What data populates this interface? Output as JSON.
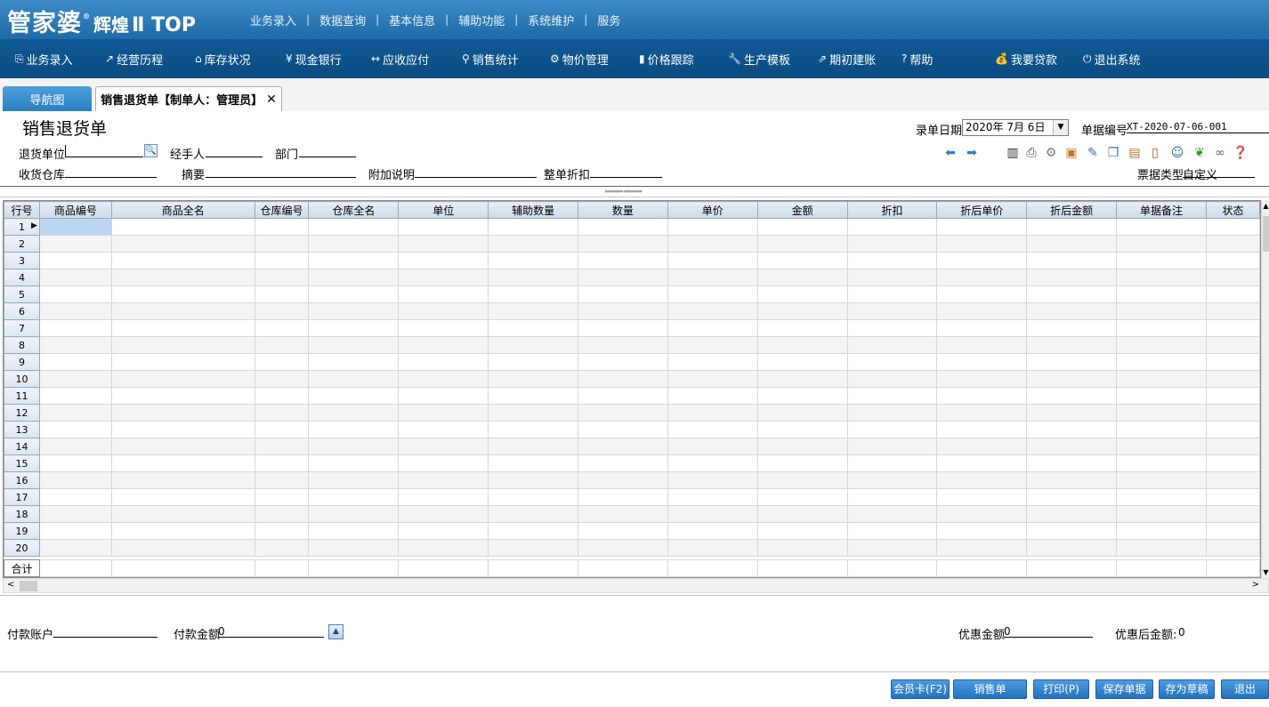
{
  "app": {
    "logo_main": "管家婆",
    "logo_sub": "辉煌",
    "logo_tail": "Ⅱ TOP",
    "logo_reg": "®"
  },
  "top_menu": [
    "业务录入",
    "数据查询",
    "基本信息",
    "辅助功能",
    "系统维护",
    "服务"
  ],
  "top_menu_sep": "|",
  "nav": [
    {
      "icon": "⎘",
      "label": "业务录入",
      "icon_name": "entry-icon"
    },
    {
      "icon": "↗",
      "label": "经营历程",
      "icon_name": "chart-line-icon"
    },
    {
      "icon": "⌂",
      "label": "库存状况",
      "icon_name": "home-icon"
    },
    {
      "icon": "¥",
      "label": "现金银行",
      "icon_name": "yen-icon"
    },
    {
      "icon": "↔",
      "label": "应收应付",
      "icon_name": "exchange-icon"
    },
    {
      "icon": "⚲",
      "label": "销售统计",
      "icon_name": "search-icon"
    },
    {
      "icon": "⚙",
      "label": "物价管理",
      "icon_name": "gear-icon"
    },
    {
      "icon": "▮",
      "label": "价格跟踪",
      "icon_name": "bar-chart-icon"
    },
    {
      "icon": "🔧",
      "label": "生产模板",
      "icon_name": "wrench-icon"
    },
    {
      "icon": "⇗",
      "label": "期初建账",
      "icon_name": "export-icon"
    },
    {
      "icon": "?",
      "label": "帮助",
      "icon_name": "help-icon"
    },
    {
      "icon": "💰",
      "label": "我要贷款",
      "icon_name": "money-bag-icon"
    },
    {
      "icon": "⏻",
      "label": "退出系统",
      "icon_name": "power-icon"
    }
  ],
  "tabs": {
    "nav_tab": "导航图",
    "current_tab": "销售退货单【制单人：管理员】",
    "close": "✕"
  },
  "form": {
    "title": "销售退货单",
    "return_unit_label": "退货单位",
    "return_unit_value": "",
    "handler_label": "经手人",
    "dept_label": "部门",
    "warehouse_label": "收货仓库",
    "summary_label": "摘要",
    "extra_label": "附加说明",
    "discount_label": "整单折扣",
    "date_label": "录单日期",
    "date_value": "2020年 7月 6日",
    "docno_label": "单据编号",
    "docno_value": "XT-2020-07-06-001",
    "doctype_label": "票据类型",
    "doctype_value": "自定义"
  },
  "toolbar_icons": [
    "arrow-left-icon",
    "arrow-right-icon",
    "barcode-icon",
    "print-icon",
    "settings-icon",
    "add-item-icon",
    "edit-icon",
    "copy-icon",
    "package-icon",
    "door-icon",
    "user-icon",
    "leaf-icon",
    "link-icon",
    "help-circle-icon"
  ],
  "grid": {
    "columns": [
      "行号",
      "商品编号",
      "商品全名",
      "仓库编号",
      "仓库全名",
      "单位",
      "辅助数量",
      "数量",
      "单价",
      "金额",
      "折扣",
      "折后单价",
      "折后金额",
      "单据备注",
      "状态"
    ],
    "rows": [
      "1",
      "2",
      "3",
      "4",
      "5",
      "6",
      "7",
      "8",
      "9",
      "10",
      "11",
      "12",
      "13",
      "14",
      "15",
      "16",
      "17",
      "18",
      "19",
      "20"
    ],
    "total_label": "合计"
  },
  "bottom": {
    "pay_account_label": "付款账户",
    "pay_amount_label": "付款金额",
    "pay_amount_value": "0",
    "discount_amount_label": "优惠金额",
    "discount_amount_value": "0",
    "after_discount_label": "优惠后金额:",
    "after_discount_value": "0"
  },
  "buttons": {
    "member_card": "会员卡(F2)",
    "sales_order": "销售单",
    "print": "打印(P)",
    "save": "保存单据",
    "draft": "存为草稿",
    "exit": "退出"
  }
}
